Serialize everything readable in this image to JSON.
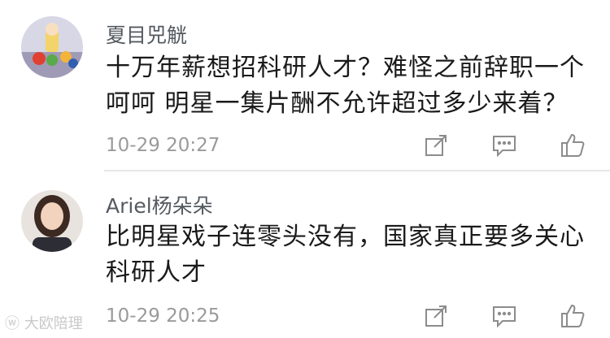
{
  "comments": [
    {
      "username": "夏目兕觥",
      "lines": [
        "十万年薪想招科研人才？难怪之前辞职一个",
        "呵呵 明星一集片酬不允许超过多少来着？"
      ],
      "time": "10-29 20:27",
      "actions": [
        "share-icon",
        "reply-icon",
        "like-icon"
      ]
    },
    {
      "username": "Ariel杨朵朵",
      "lines": [
        "比明星戏子连零头没有，国家真正要多关心",
        "科研人才"
      ],
      "time": "10-29 20:25",
      "actions": [
        "share-icon",
        "reply-icon",
        "like-icon"
      ]
    }
  ],
  "watermark": "大欧陪理",
  "colors": {
    "text": "#1a1a1a",
    "username": "#555a60",
    "time": "#9a9a9a",
    "icon": "#8c8c8c"
  }
}
